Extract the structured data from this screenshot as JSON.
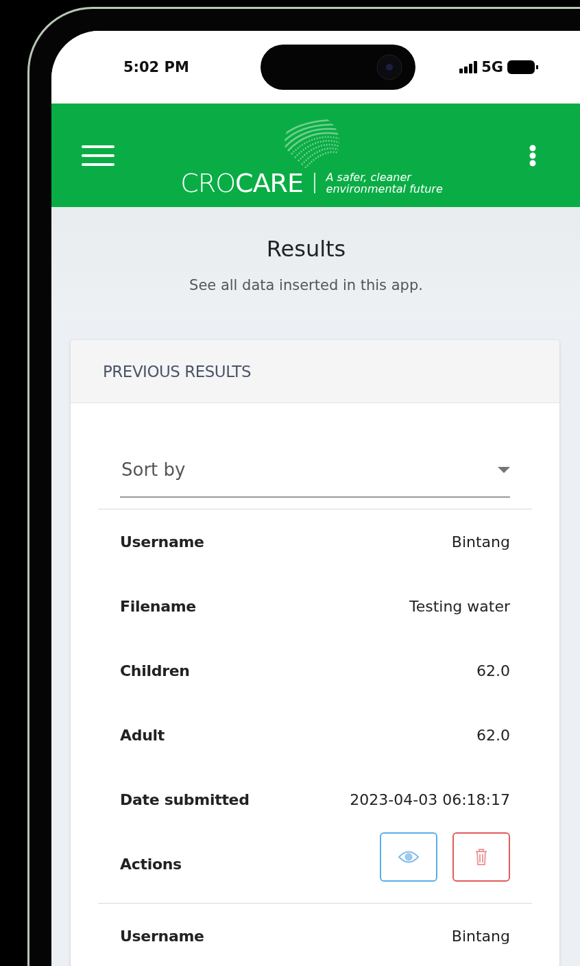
{
  "status_bar": {
    "time": "5:02 PM",
    "network": "5G"
  },
  "header": {
    "brand": "CRO**CARE**",
    "tagline": [
      "A safer, cleaner",
      "environmental future"
    ]
  },
  "page": {
    "title": "Results",
    "subtitle": "See all data inserted in this app."
  },
  "card": {
    "title": "PREVIOUS RESULTS",
    "sort": {
      "placeholder": "Sort by"
    },
    "records": [
      {
        "fields": [
          {
            "label": "Username",
            "value": "Bintang"
          },
          {
            "label": "Filename",
            "value": "Testing water"
          },
          {
            "label": "Children",
            "value": "62.0"
          },
          {
            "label": "Adult",
            "value": "62.0"
          },
          {
            "label": "Date submitted",
            "value": "2023-04-03 06:18:17"
          }
        ],
        "actions": {
          "label": "Actions",
          "buttons": [
            {
              "kind": "view"
            },
            {
              "kind": "delete"
            }
          ]
        }
      },
      {
        "fields": [
          {
            "label": "Username",
            "value": "Bintang"
          }
        ]
      }
    ]
  }
}
